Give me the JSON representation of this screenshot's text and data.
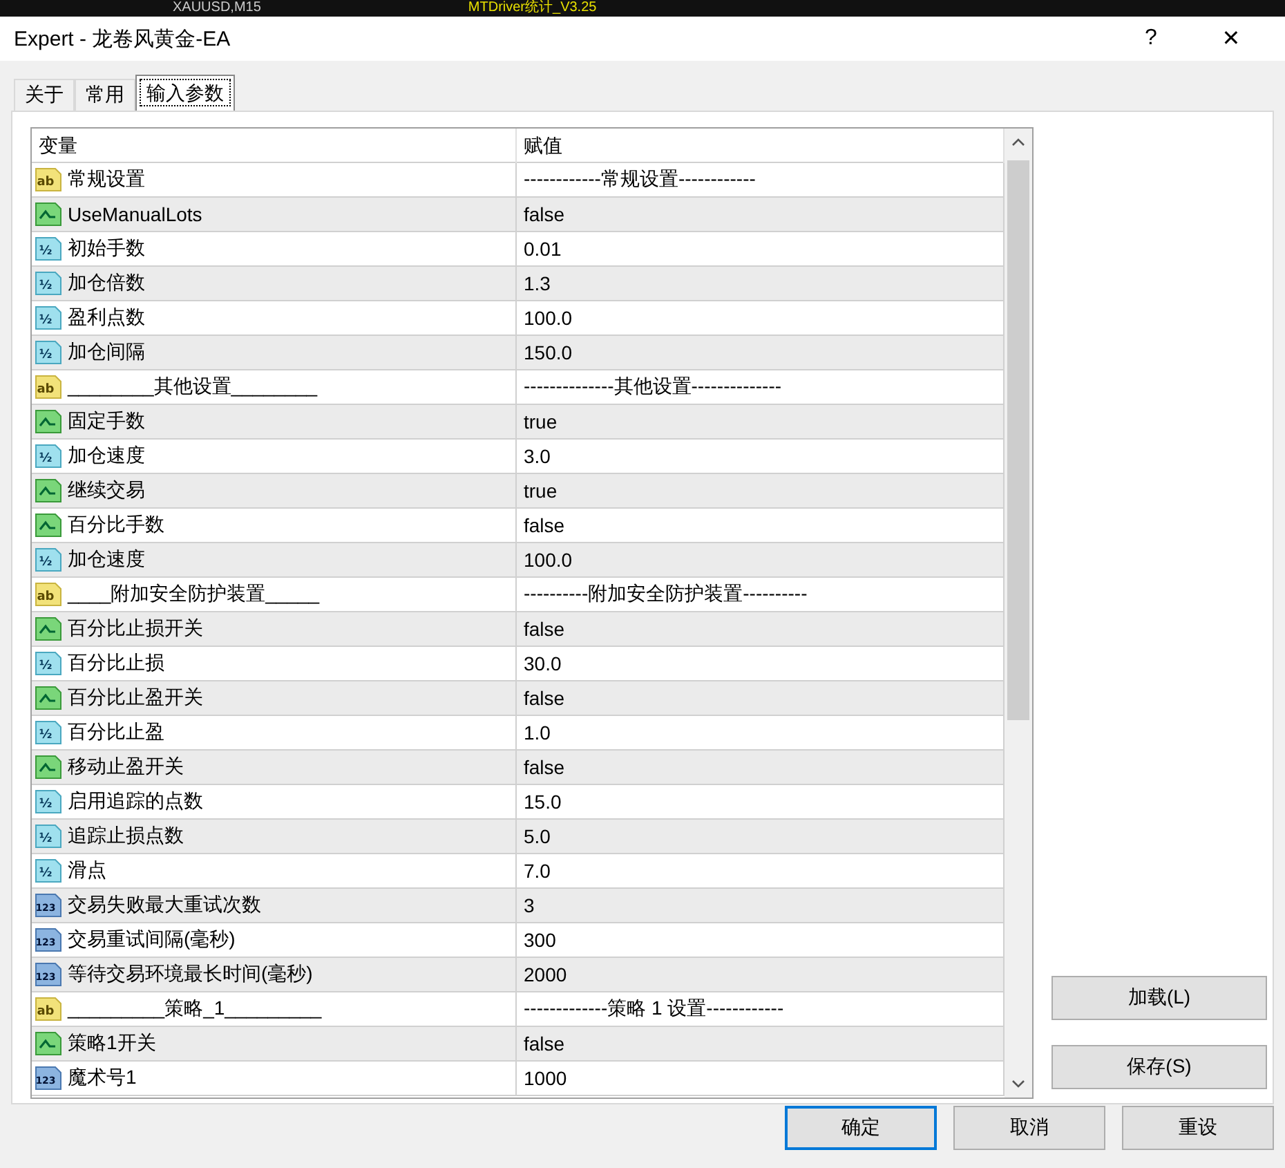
{
  "background": {
    "chart_title": "XAUUSD,M15",
    "indicator_label": "MTDriver统计_V3.25"
  },
  "window": {
    "title": "Expert - 龙卷风黄金-EA",
    "help": "?",
    "close": "✕"
  },
  "tabs": [
    {
      "label": "关于",
      "selected": false
    },
    {
      "label": "常用",
      "selected": false
    },
    {
      "label": "输入参数",
      "selected": true
    }
  ],
  "table": {
    "columns": [
      "变量",
      "赋值"
    ],
    "rows": [
      {
        "kind": "string",
        "icon": "ab",
        "name": "常规设置",
        "value": "------------常规设置------------"
      },
      {
        "kind": "bool",
        "name": "UseManualLots",
        "value": "false"
      },
      {
        "kind": "double",
        "icon": "½",
        "name": "初始手数",
        "value": "0.01"
      },
      {
        "kind": "double",
        "icon": "½",
        "name": "加仓倍数",
        "value": "1.3"
      },
      {
        "kind": "double",
        "icon": "½",
        "name": "盈利点数",
        "value": "100.0"
      },
      {
        "kind": "double",
        "icon": "½",
        "name": "加仓间隔",
        "value": "150.0"
      },
      {
        "kind": "string",
        "icon": "ab",
        "name": "________其他设置________",
        "value": "--------------其他设置--------------"
      },
      {
        "kind": "bool",
        "name": "固定手数",
        "value": "true"
      },
      {
        "kind": "double",
        "icon": "½",
        "name": "加仓速度",
        "value": "3.0"
      },
      {
        "kind": "bool",
        "name": "继续交易",
        "value": "true"
      },
      {
        "kind": "bool",
        "name": "百分比手数",
        "value": "false"
      },
      {
        "kind": "double",
        "icon": "½",
        "name": "加仓速度",
        "value": "100.0"
      },
      {
        "kind": "string",
        "icon": "ab",
        "name": "____附加安全防护装置_____",
        "value": "----------附加安全防护装置----------"
      },
      {
        "kind": "bool",
        "name": "百分比止损开关",
        "value": "false"
      },
      {
        "kind": "double",
        "icon": "½",
        "name": "百分比止损",
        "value": "30.0"
      },
      {
        "kind": "bool",
        "name": "百分比止盈开关",
        "value": "false"
      },
      {
        "kind": "double",
        "icon": "½",
        "name": "百分比止盈",
        "value": "1.0"
      },
      {
        "kind": "bool",
        "name": "移动止盈开关",
        "value": "false"
      },
      {
        "kind": "double",
        "icon": "½",
        "name": "启用追踪的点数",
        "value": "15.0"
      },
      {
        "kind": "double",
        "icon": "½",
        "name": "追踪止损点数",
        "value": "5.0"
      },
      {
        "kind": "double",
        "icon": "½",
        "name": "滑点",
        "value": "7.0"
      },
      {
        "kind": "int",
        "icon": "123",
        "name": "交易失败最大重试次数",
        "value": "3"
      },
      {
        "kind": "int",
        "icon": "123",
        "name": "交易重试间隔(毫秒)",
        "value": "300"
      },
      {
        "kind": "int",
        "icon": "123",
        "name": "等待交易环境最长时间(毫秒)",
        "value": "2000"
      },
      {
        "kind": "string",
        "icon": "ab",
        "name": "_________策略_1_________",
        "value": "-------------策略 1 设置------------"
      },
      {
        "kind": "bool",
        "name": "策略1开关",
        "value": "false"
      },
      {
        "kind": "int",
        "icon": "123",
        "name": "魔术号1",
        "value": "1000"
      }
    ]
  },
  "side_buttons": [
    "加载(L)",
    "保存(S)"
  ],
  "footer_buttons": [
    {
      "label": "确定",
      "default": true
    },
    {
      "label": "取消",
      "default": false
    },
    {
      "label": "重设",
      "default": false
    }
  ]
}
